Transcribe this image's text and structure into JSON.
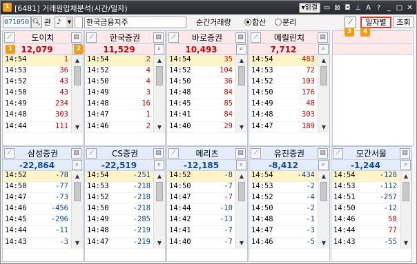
{
  "window": {
    "number": "1",
    "title": "[6481] 거래원입체분석(시간/일자)",
    "link_label": "▾읽결",
    "icons": [
      "monitor-icon",
      "close-box-icon",
      "lock-icon",
      "pin-icon",
      "font-icon",
      "help-icon",
      "minimize-icon",
      "maximize-icon",
      "close-icon"
    ]
  },
  "toolbar": {
    "code": "071050",
    "kwan": "관",
    "stock_name": "한국금융지주",
    "volume_label": "순간거래량",
    "opt_sum": "합산",
    "opt_split": "분리",
    "daily_button": "일자별",
    "query_button": "조회"
  },
  "badges": [
    "1",
    "2",
    "3",
    "4"
  ],
  "buy_panels": [
    {
      "name": "도이치",
      "total": "12,079",
      "rows": [
        {
          "t": "14:54",
          "v": "1"
        },
        {
          "t": "14:53",
          "v": "36"
        },
        {
          "t": "14:52",
          "v": "43"
        },
        {
          "t": "14:50",
          "v": "43"
        },
        {
          "t": "14:49",
          "v": "234"
        },
        {
          "t": "14:48",
          "v": "303"
        },
        {
          "t": "14:44",
          "v": "111"
        }
      ]
    },
    {
      "name": "한국증권",
      "total": "11,529",
      "rows": [
        {
          "t": "14:54",
          "v": "2"
        },
        {
          "t": "14:52",
          "v": "4"
        },
        {
          "t": "14:50",
          "v": "4"
        },
        {
          "t": "14:49",
          "v": "3"
        },
        {
          "t": "14:48",
          "v": "16"
        },
        {
          "t": "14:47",
          "v": "1"
        },
        {
          "t": "14:46",
          "v": "2"
        }
      ]
    },
    {
      "name": "바로증권",
      "total": "10,493",
      "rows": [
        {
          "t": "14:54",
          "v": "35"
        },
        {
          "t": "14:52",
          "v": "104"
        },
        {
          "t": "14:50",
          "v": "36"
        },
        {
          "t": "14:48",
          "v": "84"
        },
        {
          "t": "14:45",
          "v": "85"
        },
        {
          "t": "14:41",
          "v": "84"
        },
        {
          "t": "14:40",
          "v": "29"
        }
      ]
    },
    {
      "name": "메릴린치",
      "total": "7,712",
      "rows": [
        {
          "t": "14:54",
          "v": "483"
        },
        {
          "t": "14:53",
          "v": "72"
        },
        {
          "t": "14:52",
          "v": "103"
        },
        {
          "t": "14:50",
          "v": "176"
        },
        {
          "t": "14:49",
          "v": "48"
        },
        {
          "t": "14:48",
          "v": "303"
        },
        {
          "t": "14:47",
          "v": "189"
        }
      ]
    }
  ],
  "sell_panels": [
    {
      "name": "삼성증권",
      "total": "-22,864",
      "rows": [
        {
          "t": "14:52",
          "v": "-78"
        },
        {
          "t": "14:50",
          "v": "-77"
        },
        {
          "t": "14:47",
          "v": "-73"
        },
        {
          "t": "14:46",
          "v": "-456"
        },
        {
          "t": "14:45",
          "v": "-296"
        },
        {
          "t": "14:44",
          "v": "-11"
        },
        {
          "t": "14:43",
          "v": "-3"
        }
      ]
    },
    {
      "name": "CS증권",
      "total": "-22,519",
      "rows": [
        {
          "t": "14:54",
          "v": "-251"
        },
        {
          "t": "14:53",
          "v": "-218"
        },
        {
          "t": "14:52",
          "v": "-218"
        },
        {
          "t": "14:50",
          "v": "-218"
        },
        {
          "t": "14:49",
          "v": "-285"
        },
        {
          "t": "14:48",
          "v": "-219"
        },
        {
          "t": "14:47",
          "v": "-219"
        }
      ]
    },
    {
      "name": "메리츠",
      "total": "-12,185",
      "rows": [
        {
          "t": "14:52",
          "v": "-8"
        },
        {
          "t": "14:50",
          "v": "-7"
        },
        {
          "t": "14:47",
          "v": "-7"
        },
        {
          "t": "14:44",
          "v": "-10"
        },
        {
          "t": "14:42",
          "v": "-13"
        },
        {
          "t": "14:41",
          "v": "-7"
        },
        {
          "t": "14:40",
          "v": "-7"
        }
      ]
    },
    {
      "name": "유진증권",
      "total": "-8,412",
      "rows": [
        {
          "t": "14:54",
          "v": "-434"
        },
        {
          "t": "14:53",
          "v": "-2"
        },
        {
          "t": "14:52",
          "v": "-4"
        },
        {
          "t": "14:50",
          "v": "-2"
        },
        {
          "t": "14:48",
          "v": "-1"
        },
        {
          "t": "14:47",
          "v": "-3"
        },
        {
          "t": "14:46",
          "v": "-5"
        }
      ]
    },
    {
      "name": "모간서울",
      "total": "-1,244",
      "rows": [
        {
          "t": "14:54",
          "v": "-128"
        },
        {
          "t": "14:53",
          "v": "-112"
        },
        {
          "t": "14:51",
          "v": "-257"
        },
        {
          "t": "14:50",
          "v": "-12"
        },
        {
          "t": "14:46",
          "v": "58"
        },
        {
          "t": "14:44",
          "v": "77"
        },
        {
          "t": "14:43",
          "v": "-55"
        }
      ]
    }
  ]
}
